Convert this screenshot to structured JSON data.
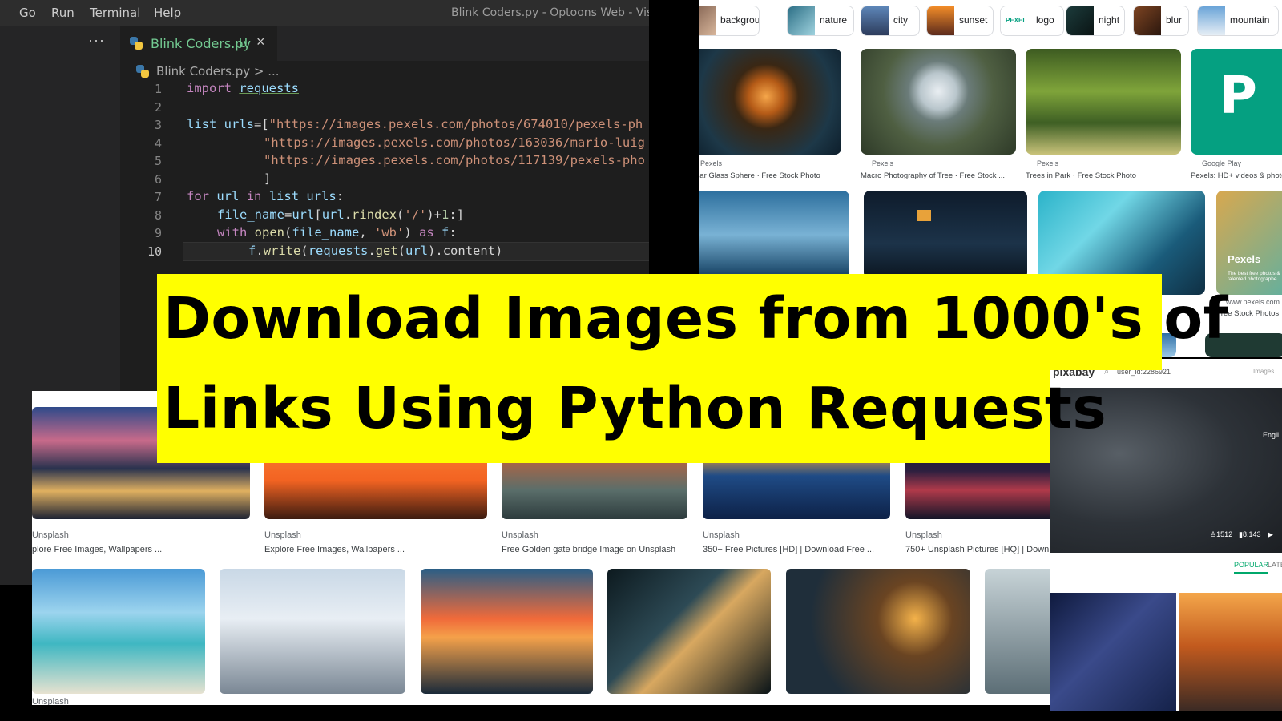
{
  "vscode": {
    "menu": [
      "Go",
      "Run",
      "Terminal",
      "Help"
    ],
    "window_title": "Blink Coders.py - Optoons Web - Visu",
    "explorer_dots": "···",
    "tab": {
      "label": "Blink Coders.py",
      "status": "U",
      "close": "×"
    },
    "breadcrumb": "Blink Coders.py > ...",
    "line_numbers": [
      "1",
      "2",
      "3",
      "4",
      "5",
      "6",
      "7",
      "8",
      "9",
      "10"
    ],
    "code": {
      "l1_kw": "import",
      "l1_mod": "requests",
      "l3_var": "list_urls",
      "l3_rest": "=[",
      "l3_str": "\"https://images.pexels.com/photos/674010/pexels-ph",
      "l4_str": "\"https://images.pexels.com/photos/163036/mario-luig",
      "l5_str": "\"https://images.pexels.com/photos/117139/pexels-pho",
      "l6": "]",
      "l7_for": "for",
      "l7_url": "url",
      "l7_in": "in",
      "l7_list": "list_urls",
      "l7_colon": ":",
      "l8_var": "file_name",
      "l8_eq": "=",
      "l8_url": "url",
      "l8_b1": "[",
      "l8_url2": "url",
      "l8_dot": ".",
      "l8_fn": "rindex",
      "l8_p1": "(",
      "l8_str": "'/'",
      "l8_p2": ")+",
      "l8_num": "1",
      "l8_end": ":]",
      "l9_with": "with",
      "l9_fn": "open",
      "l9_p1": "(",
      "l9_var": "file_name",
      "l9_comma": ", ",
      "l9_str": "'wb'",
      "l9_p2": ")",
      "l9_as": "as",
      "l9_f": "f",
      "l9_colon": ":",
      "l10_f": "f",
      "l10_dot": ".",
      "l10_fn": "write",
      "l10_p1": "(",
      "l10_mod": "requests",
      "l10_dot2": ".",
      "l10_get": "get",
      "l10_p2": "(",
      "l10_url": "url",
      "l10_end": ").content)"
    }
  },
  "google": {
    "chips": [
      "background",
      "nature",
      "city",
      "sunset",
      "logo",
      "night",
      "blur",
      "mountain"
    ],
    "pexel_chip_text": "PEXEL",
    "results_row1": [
      {
        "source": "Pexels",
        "caption": "ear Glass Sphere · Free Stock Photo"
      },
      {
        "source": "Pexels",
        "caption": "Macro Photography of Tree · Free Stock ..."
      },
      {
        "source": "Pexels",
        "caption": "Trees in Park · Free Stock Photo"
      },
      {
        "source": "Google Play",
        "caption": "Pexels: HD+ videos & photo"
      }
    ],
    "pexels_card": {
      "brand": "Pexels",
      "tagline": "The best free photos & talented photographe",
      "site": "www.pexels.com",
      "caption": "Free Stock Photos,"
    }
  },
  "unsplash": {
    "row1": [
      {
        "source": "Unsplash",
        "caption": "plore Free Images, Wallpapers ..."
      },
      {
        "source": "Unsplash",
        "caption": "Explore Free Images, Wallpapers ..."
      },
      {
        "source": "Unsplash",
        "caption": "Free Golden gate bridge Image on Unsplash"
      },
      {
        "source": "Unsplash",
        "caption": "350+ Free Pictures [HD] | Download Free ..."
      },
      {
        "source": "Unsplash",
        "caption": "750+ Unsplash Pictures [HQ] | Downl"
      }
    ],
    "row2_source": "Unsplash"
  },
  "pixabay": {
    "logo": "pixabay",
    "search": "user_id:2286921",
    "scope": "Images",
    "lang": "Engli",
    "stats": {
      "likes": "1512",
      "downloads": "8,143"
    },
    "tabs": [
      "POPULAR",
      "LATES"
    ]
  },
  "banner": {
    "line1": "Download Images from 1000's of",
    "line2": "Links Using Python Requests"
  },
  "colors": {
    "banner": "#ffff00",
    "editor_bg": "#1e1e1e",
    "keyword": "#c586c0",
    "string": "#ce9178",
    "function": "#dcdcaa",
    "variable": "#9cdcfe"
  }
}
